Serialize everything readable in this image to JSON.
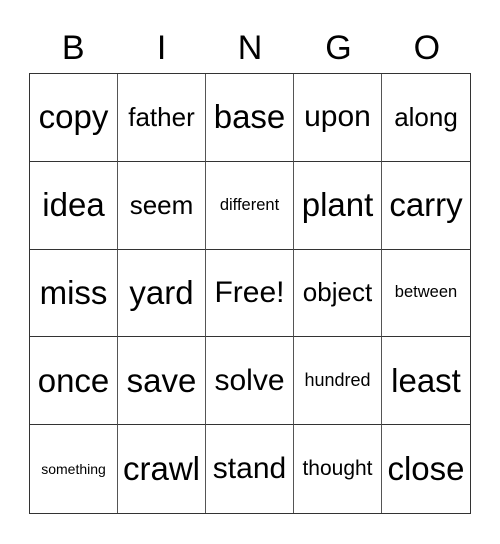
{
  "header": {
    "letters": [
      "B",
      "I",
      "N",
      "G",
      "O"
    ]
  },
  "grid": {
    "rows": [
      [
        "copy",
        "father",
        "base",
        "upon",
        "along"
      ],
      [
        "idea",
        "seem",
        "different",
        "plant",
        "carry"
      ],
      [
        "miss",
        "yard",
        "Free!",
        "object",
        "between"
      ],
      [
        "once",
        "save",
        "solve",
        "hundred",
        "least"
      ],
      [
        "something",
        "crawl",
        "stand",
        "thought",
        "close"
      ]
    ]
  }
}
